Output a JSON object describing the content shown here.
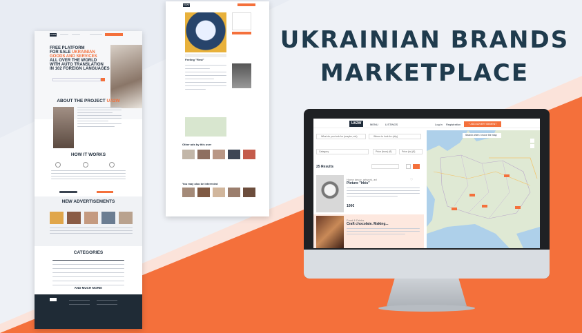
{
  "headline": {
    "line1": "UKRAINIAN BRANDS",
    "line2": "MARKETPLACE"
  },
  "colors": {
    "accent": "#f4703b",
    "navy": "#1f3b4d",
    "dark": "#1e2b3a"
  },
  "landing": {
    "logo": "UA2W",
    "hero_lines": [
      "FREE PLATFORM",
      "FOR SALE",
      "GOODS AND SERVICES",
      "ALL OVER THE WORLD",
      "WITH AUTO TRANSLATION",
      "IN 102 FOREIGN LANGUAGES"
    ],
    "hero_accent": "UKRAINIAN",
    "about_title": "ABOUT THE PROJECT",
    "about_accent": "UA2W",
    "how_title": "HOW IT WORKS",
    "new_ads_title": "NEW ADVERTISEMENTS",
    "categories_title": "CATEGORIES",
    "more_label": "AND MUCH MORE!"
  },
  "detail": {
    "logo": "UA2W",
    "item_title": "Feeling \"Rest\"",
    "section_other": "Other ads by this user",
    "section_like": "You may also be interested"
  },
  "screen": {
    "logo": "UA2W",
    "nav": [
      "MENU",
      "LISTINGS"
    ],
    "login": "Log in",
    "register": "Registration",
    "cta": "+ ADD ADVERTISEMENT",
    "search_placeholder": "What do you look for (maybe, etc)",
    "location_placeholder": "Where to look for (city)",
    "filter_category": "Category",
    "filter_price_from": "Price (from) (€)",
    "filter_price_to": "Price (to) (€)",
    "results": "25 Results",
    "map_toggle": "Search when I move the map",
    "listings": [
      {
        "category": "Home decor, artwork, art",
        "title": "Picture \"Irbis\"",
        "price": "100€"
      },
      {
        "category": "Food & Drinks",
        "title": "Craft chocolate. Making..."
      }
    ]
  }
}
